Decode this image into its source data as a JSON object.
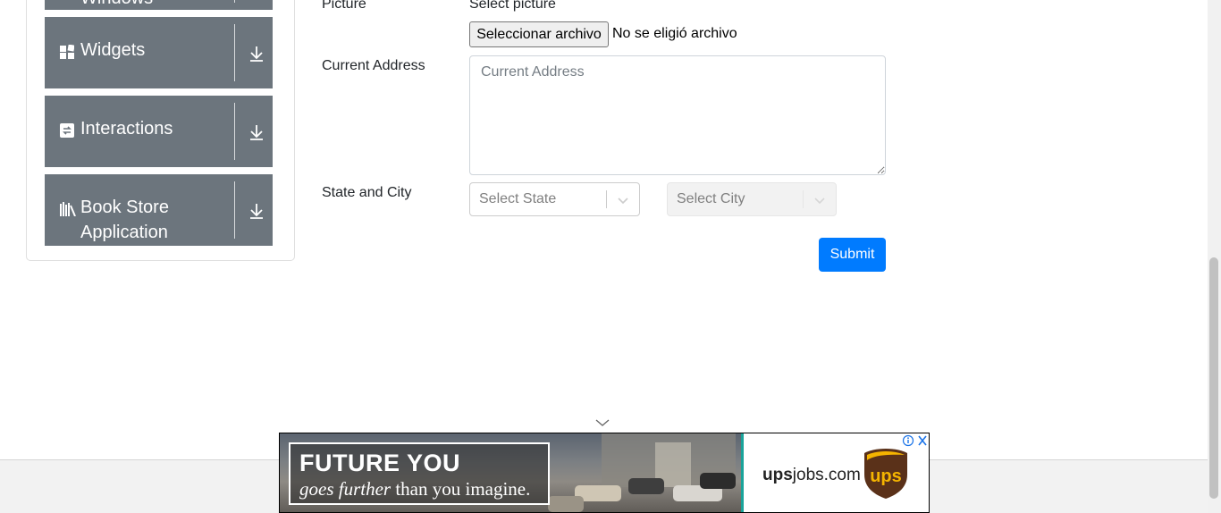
{
  "sidebar": {
    "groups": [
      {
        "label": "Windows",
        "icon": "window-icon"
      },
      {
        "label": "Widgets",
        "icon": "widgets-icon"
      },
      {
        "label": "Interactions",
        "icon": "interactions-icon"
      },
      {
        "label": "Book Store",
        "label2": "Application",
        "icon": "book-store-icon"
      }
    ]
  },
  "form": {
    "picture_label": "Picture",
    "picture_hint": "Select picture",
    "file_button": "Seleccionar archivo",
    "file_status": "No se eligió archivo",
    "address_label": "Current Address",
    "address_placeholder": "Current Address",
    "state_city_label": "State and City",
    "state_placeholder": "Select State",
    "city_placeholder": "Select City",
    "submit_label": "Submit"
  },
  "ad": {
    "headline": "FUTURE YOU",
    "sub_italic": "goes further",
    "sub_rest": " than you imagine.",
    "site_bold": "ups",
    "site_rest": "jobs.com",
    "logo_text": "ups"
  },
  "colors": {
    "sidebar_group": "#6c757d",
    "submit": "#007bff",
    "ad_accent": "#1aa39a",
    "ups_brown": "#5a3119",
    "ups_gold": "#f5b400"
  }
}
